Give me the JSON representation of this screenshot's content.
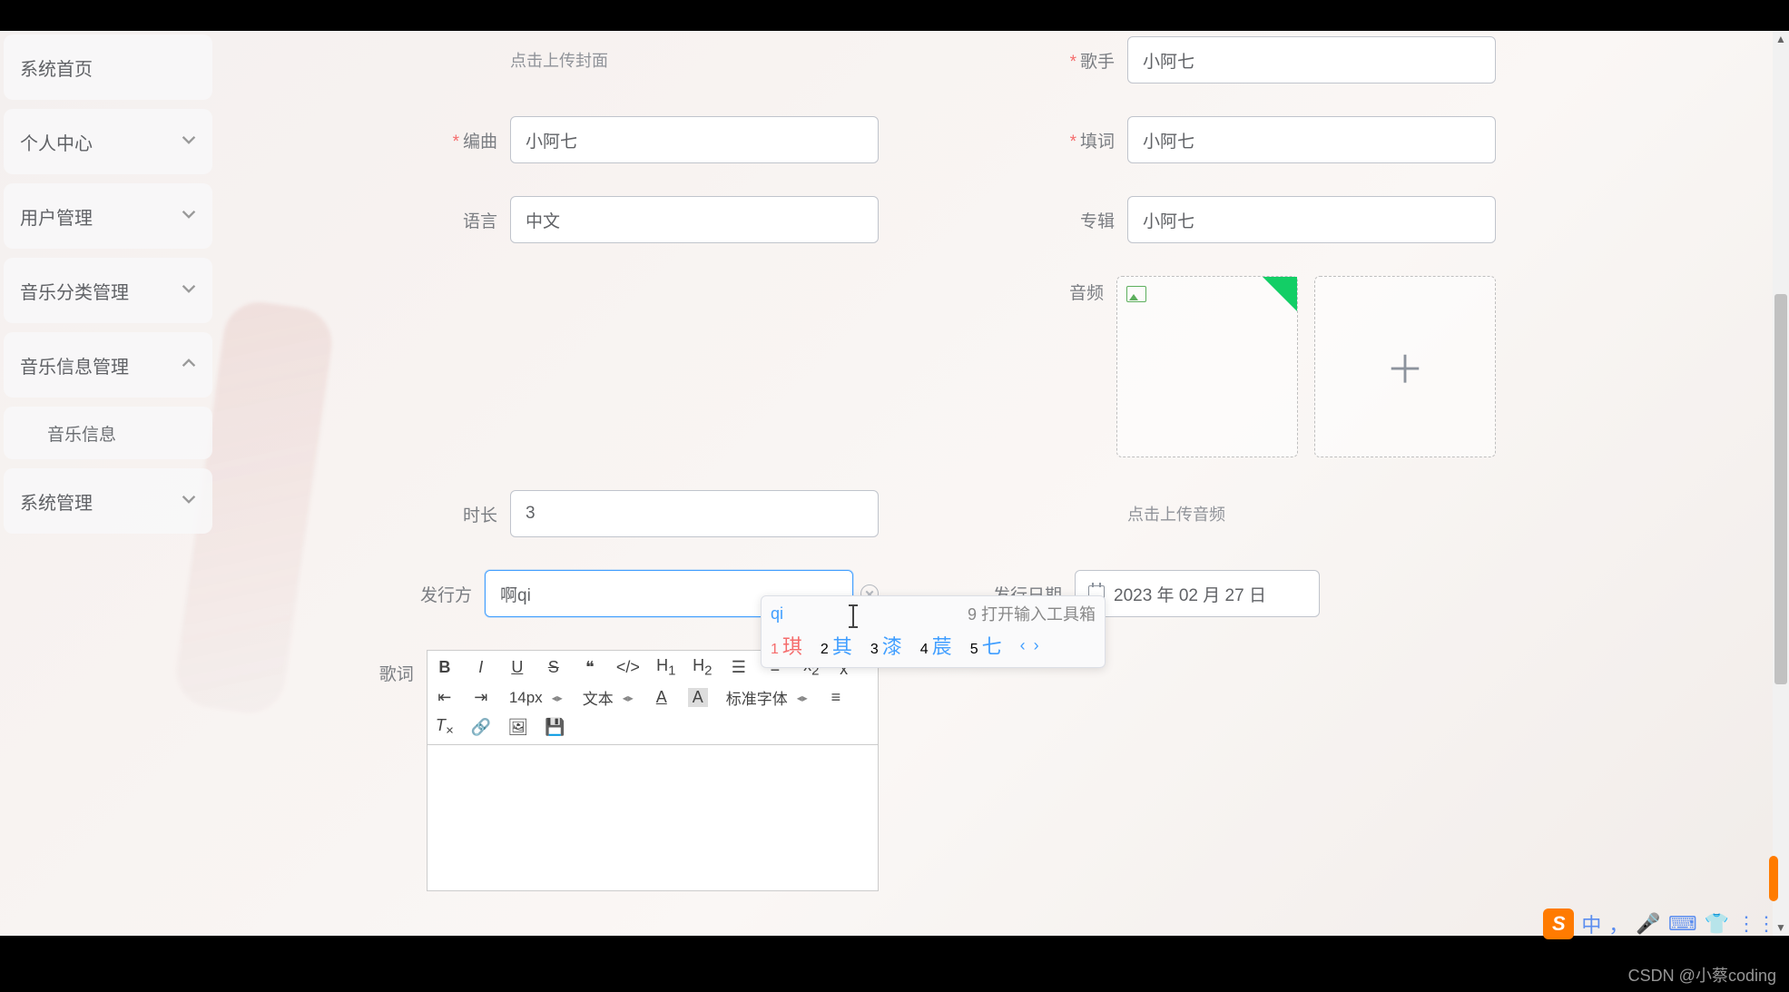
{
  "sidebar": {
    "items": [
      {
        "label": "系统首页",
        "expandable": false
      },
      {
        "label": "个人中心",
        "expandable": true,
        "open": false
      },
      {
        "label": "用户管理",
        "expandable": true,
        "open": false
      },
      {
        "label": "音乐分类管理",
        "expandable": true,
        "open": false
      },
      {
        "label": "音乐信息管理",
        "expandable": true,
        "open": true
      },
      {
        "label": "系统管理",
        "expandable": true,
        "open": false
      }
    ],
    "sub_item": "音乐信息"
  },
  "form": {
    "cover_hint": "点击上传封面",
    "singer_label": "歌手",
    "singer_value": "小阿七",
    "arranger_label": "编曲",
    "arranger_value": "小阿七",
    "lyricist_label": "填词",
    "lyricist_value": "小阿七",
    "language_label": "语言",
    "language_value": "中文",
    "album_label": "专辑",
    "album_value": "小阿七",
    "audio_label": "音频",
    "audio_hint": "点击上传音频",
    "duration_label": "时长",
    "duration_value": "3",
    "publisher_label": "发行方",
    "publisher_value": "啊qi",
    "release_date_label": "发行日期",
    "release_date_value": "2023 年 02 月 27 日",
    "lyrics_label": "歌词",
    "add_icon": "＋"
  },
  "editor_toolbar": {
    "font_size": "14px",
    "text_style": "文本",
    "font_family": "标准字体"
  },
  "ime": {
    "pinyin": "qi",
    "toolbox_key": "9",
    "toolbox_label": "打开输入工具箱",
    "candidates": [
      {
        "n": "1",
        "w": "琪",
        "sel": true
      },
      {
        "n": "2",
        "w": "其"
      },
      {
        "n": "3",
        "w": "漆"
      },
      {
        "n": "4",
        "w": "莀"
      },
      {
        "n": "5",
        "w": "七"
      }
    ],
    "pager": "‹ ›"
  },
  "taskbar": {
    "zh": "中",
    "comma": "，",
    "mic": "🎤",
    "kbd": "⌨",
    "shirt": "👕",
    "grid": "⋮⋮"
  },
  "watermark": "CSDN @小蔡coding"
}
